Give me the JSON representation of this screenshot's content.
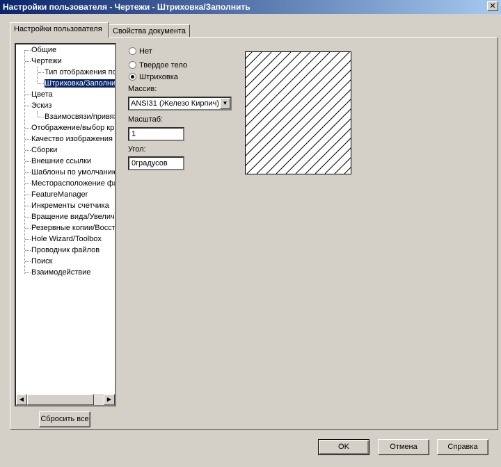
{
  "window": {
    "title": "Настройки пользователя - Чертежи - Штриховка/Заполнить",
    "close_glyph": "✕"
  },
  "tabs": [
    {
      "label": "Настройки пользователя",
      "active": true
    },
    {
      "label": "Свойства документа",
      "active": false
    }
  ],
  "tree": {
    "items": [
      {
        "label": "Общие"
      },
      {
        "label": "Чертежи"
      },
      {
        "label": "Тип отображения по"
      },
      {
        "label": "Штриховка/Заполни"
      },
      {
        "label": "Цвета"
      },
      {
        "label": "Эскиз"
      },
      {
        "label": "Взаимосвязи/привяз"
      },
      {
        "label": "Отображение/выбор кр"
      },
      {
        "label": "Качество изображения"
      },
      {
        "label": "Сборки"
      },
      {
        "label": "Внешние ссылки"
      },
      {
        "label": "Шаблоны по умолчанию"
      },
      {
        "label": "Месторасположение фа"
      },
      {
        "label": "FeatureManager"
      },
      {
        "label": "Инкременты счетчика"
      },
      {
        "label": "Вращение вида/Увелич"
      },
      {
        "label": "Резервные копии/Восст"
      },
      {
        "label": "Hole Wizard/Toolbox"
      },
      {
        "label": "Проводник файлов"
      },
      {
        "label": "Поиск"
      },
      {
        "label": "Взаимодействие"
      }
    ],
    "selected_index": 3,
    "scroll_left_glyph": "◀",
    "scroll_right_glyph": "▶"
  },
  "reset_button": "Сбросить все",
  "hatch": {
    "options": [
      {
        "label": "Нет",
        "checked": false
      },
      {
        "label": "Твердое тело",
        "checked": false
      },
      {
        "label": "Штриховка",
        "checked": true
      }
    ],
    "pattern_label": "Массив:",
    "pattern_value": "ANSI31 (Железо Кирпич)",
    "dropdown_glyph": "▼",
    "scale_label": "Масштаб:",
    "scale_value": "1",
    "angle_label": "Угол:",
    "angle_value": "0градусов"
  },
  "footer": {
    "ok": "OK",
    "cancel": "Отмена",
    "help": "Справка"
  }
}
